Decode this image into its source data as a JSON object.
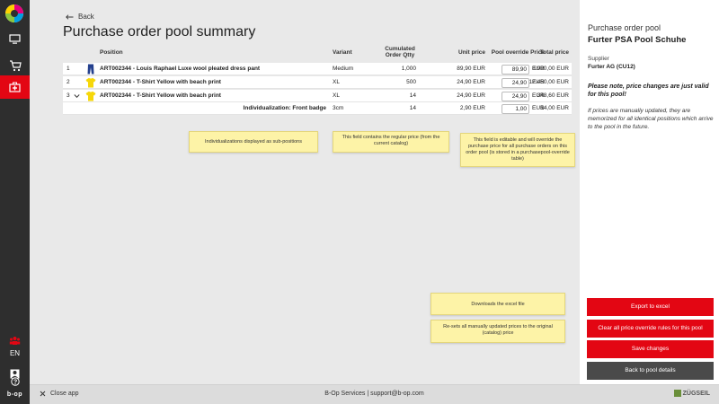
{
  "header": {
    "back_label": "Back",
    "title": "Purchase order pool summary"
  },
  "table": {
    "columns": {
      "position": "Position",
      "variant": "Variant",
      "qty": "Cumulated Order Qtty",
      "unit_price": "Unit price",
      "override": "Pool override Price",
      "total": "Total price"
    },
    "rows": [
      {
        "num": "1",
        "article": "ART002344 - Louis Raphael Luxe wool pleated dress pant",
        "variant": "Medium",
        "qty": "1,000",
        "unit_price": "89,90 EUR",
        "override": "89,90",
        "currency": "EUR",
        "total": "8.990,00 EUR",
        "image": "pants-icon"
      },
      {
        "num": "2",
        "article": "ART002344 - T-Shirt Yellow with beach print",
        "variant": "XL",
        "qty": "500",
        "unit_price": "24,90 EUR",
        "override": "24,90",
        "currency": "EUR",
        "total": "12.450,00 EUR",
        "image": "tshirt-icon"
      },
      {
        "num": "3",
        "article": "ART002344 - T-Shirt Yellow with beach print",
        "variant": "XL",
        "qty": "14",
        "unit_price": "24,90 EUR",
        "override": "24,90",
        "currency": "EUR",
        "total": "348,60 EUR",
        "image": "tshirt-icon"
      }
    ],
    "sub_row": {
      "label": "Individualization: Front badge",
      "variant": "3cm",
      "qty": "14",
      "unit_price": "2,90 EUR",
      "override": "1,00",
      "currency": "EUR",
      "total": "14,00 EUR"
    }
  },
  "notes": {
    "individualizations": "Individualizations displayed as sub-positions",
    "regular_price": "This field contains the regular price (from the current catalog)",
    "editable": "This field is editable and will override the purchase price for all purchase orders on this order pool (is stored in a purchasepool-override table)",
    "excel": "Downloads the excel file",
    "reset": "Re-sets all manually updated prices to the original (catalog) price"
  },
  "panel": {
    "title": "Purchase order pool",
    "pool_name": "Furter PSA Pool Schuhe",
    "supplier_label": "Supplier",
    "supplier": "Furter AG (CU12)",
    "warning": "Please note, price changes are just valid for this pool!",
    "info": "If prices are manually updated, they are memorized for all identical positions which arrive to the pool in the future.",
    "buttons": {
      "export": "Export to excel",
      "clear": "Clear all price override rules for this pool",
      "save": "Save changes",
      "back": "Back to pool details"
    }
  },
  "rail": {
    "language": "EN",
    "brand": "b-op"
  },
  "footer": {
    "close_label": "Close app",
    "center": "B-Op Services | support@b-op.com",
    "logo": "ZÜGSEIL"
  },
  "colors": {
    "accent": "#e30613",
    "rail": "#2e2e2e",
    "note": "#fdf3a7"
  }
}
